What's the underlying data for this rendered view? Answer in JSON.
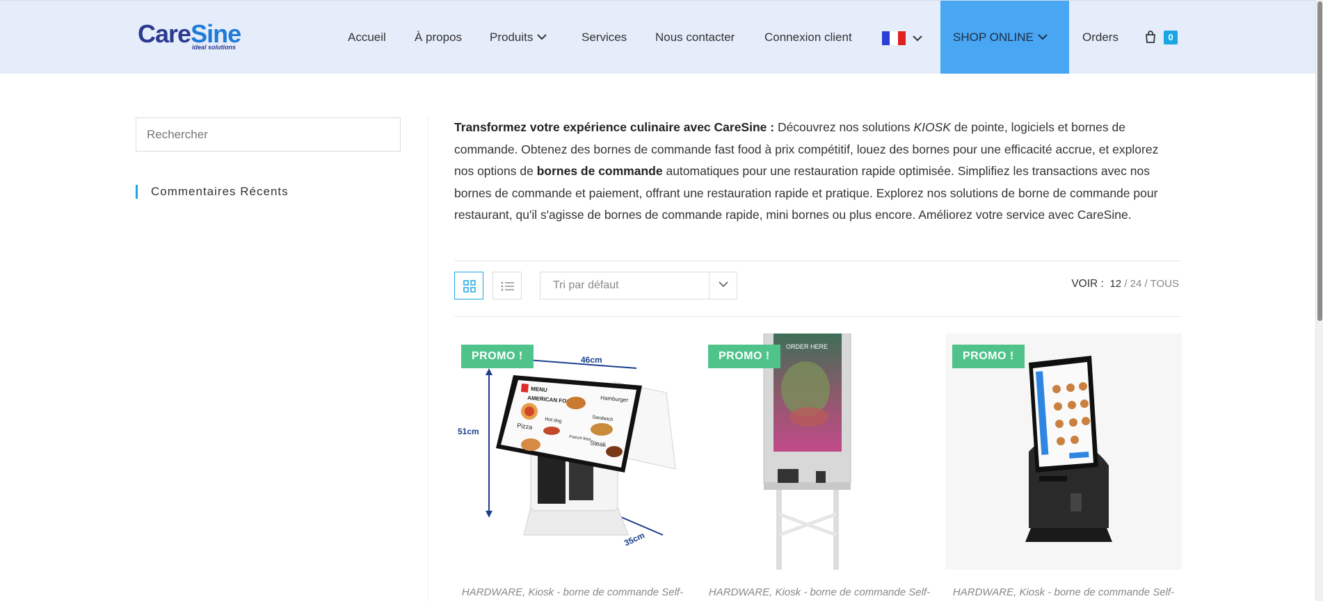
{
  "logo": {
    "care": "Care",
    "sine": "Sine",
    "tagline": "ideal solutions"
  },
  "nav": {
    "items": [
      "Accueil",
      "À propos",
      "Produits",
      "Services",
      "Nous contacter",
      "Connexion client"
    ],
    "shop": "SHOP ONLINE",
    "orders": "Orders",
    "cart_count": "0"
  },
  "colors": {
    "header_bg": "#e5ecfa",
    "shop_bg": "#49a6f3",
    "accent": "#1aa6e2",
    "promo": "#4fc38a"
  },
  "sidebar": {
    "search_placeholder": "Rechercher",
    "widget_title": "Commentaires Récents"
  },
  "intro": {
    "bold1": "Transformez votre expérience culinaire avec CareSine :",
    "t1": " Découvrez nos solutions ",
    "italic": "KIOSK",
    "t2": " de pointe, logiciels et bornes de commande. Obtenez des bornes de commande fast food à prix compétitif, louez des bornes pour une efficacité accrue, et explorez nos options de ",
    "bold2": "bornes de commande",
    "t3": " automatiques pour une restauration rapide optimisée. Simplifiez les transactions avec nos bornes de commande et paiement, offrant une restauration rapide et pratique. Explorez nos solutions de borne de commande pour restaurant, qu'il s'agisse de bornes de commande rapide, mini bornes ou plus encore. Améliorez votre service avec CareSine."
  },
  "toolbar": {
    "sort_label": "Tri par défaut",
    "voir_label": "VOIR :",
    "options": [
      "12",
      "24",
      "TOUS"
    ]
  },
  "products": [
    {
      "badge": "PROMO !",
      "category": "HARDWARE, Kiosk - borne de commande Self-",
      "dims": {
        "w": "46cm",
        "h": "51cm",
        "d": "35cm"
      },
      "screen": {
        "menu": "MENU",
        "american": "AMERICAN FOOD",
        "hamburger": "Hamburger",
        "pizza": "Pizza",
        "hotdog": "Hot dog",
        "sandwich": "Sandwich",
        "fries": "French fries",
        "steak": "Steak"
      }
    },
    {
      "badge": "PROMO !",
      "category": "HARDWARE, Kiosk - borne de commande Self-",
      "screen_text": "ORDER HERE"
    },
    {
      "badge": "PROMO !",
      "category": "HARDWARE, Kiosk - borne de commande Self-"
    }
  ]
}
